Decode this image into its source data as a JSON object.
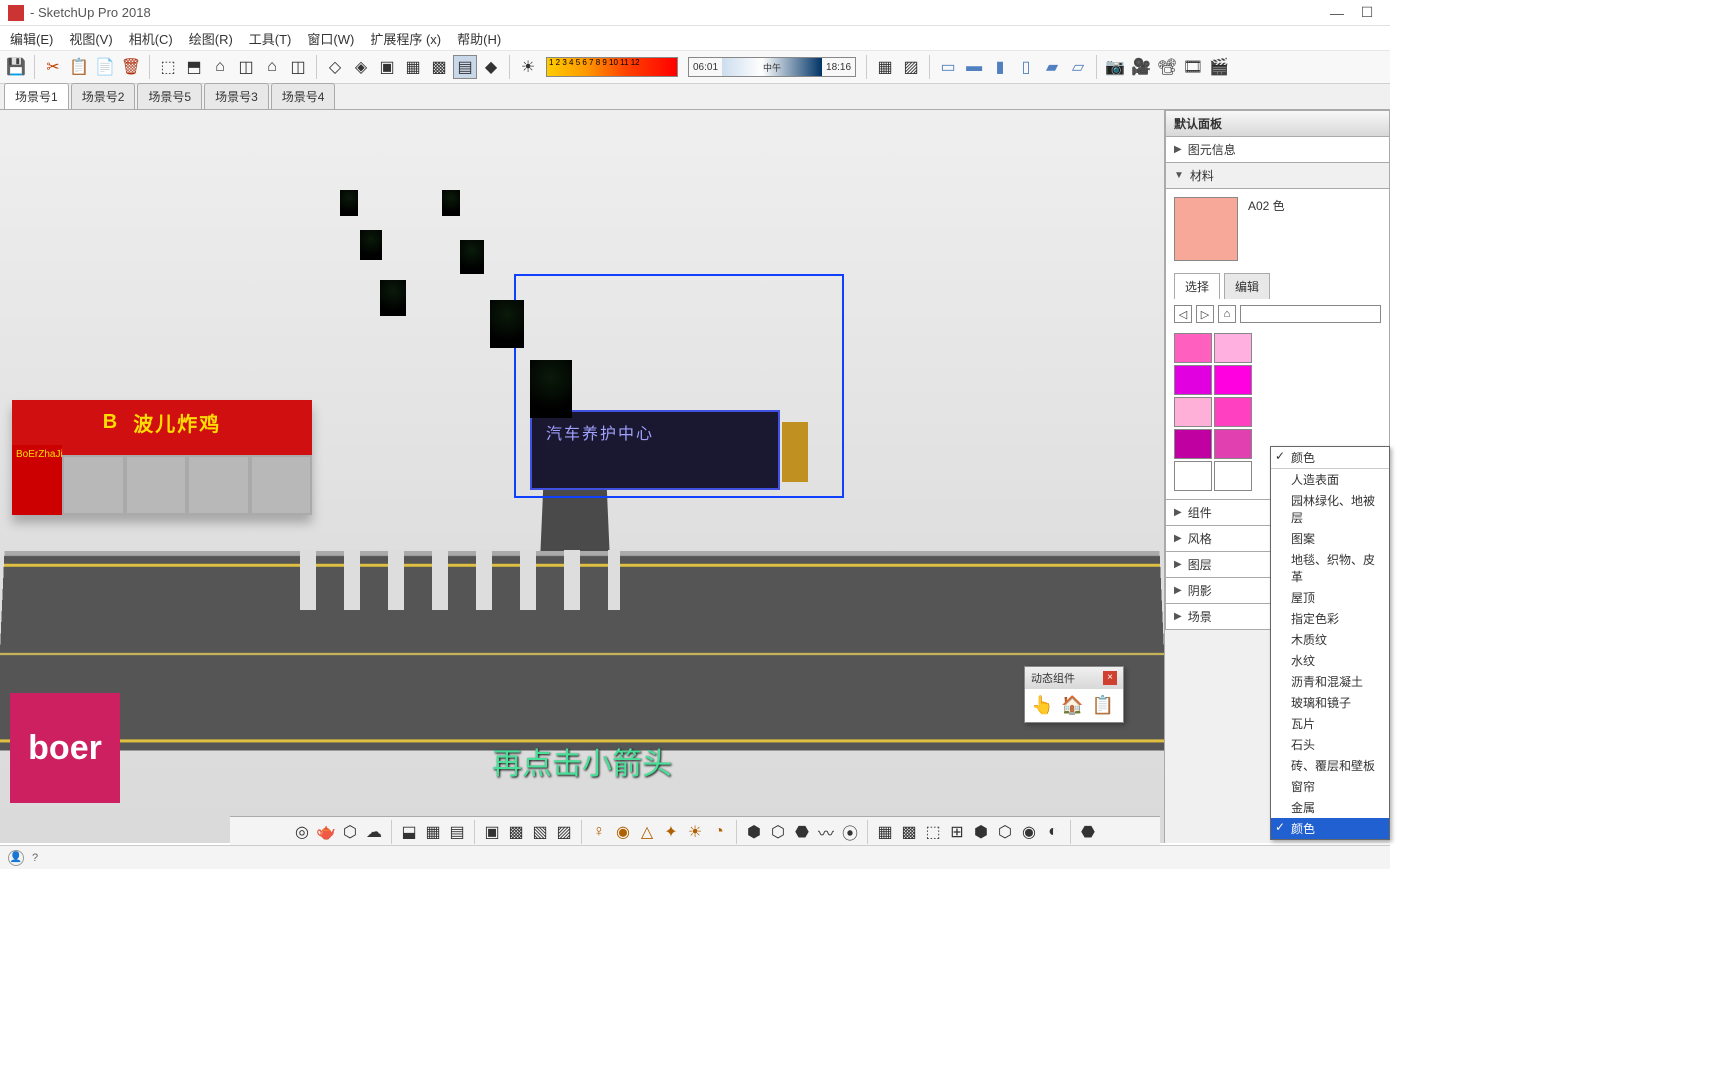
{
  "app": {
    "title": "- SketchUp Pro 2018"
  },
  "menu": {
    "items": [
      "编辑(E)",
      "视图(V)",
      "相机(C)",
      "绘图(R)",
      "工具(T)",
      "窗口(W)",
      "扩展程序 (x)",
      "帮助(H)"
    ]
  },
  "shadowBar": {
    "ticks": "1 2 3 4 5 6 7 8 9 10 11 12",
    "t1": "06:01",
    "mid": "中午",
    "t2": "18:16"
  },
  "scenes": {
    "tabs": [
      "场景号1",
      "场景号2",
      "场景号5",
      "场景号3",
      "场景号4"
    ],
    "active": 0
  },
  "signs": {
    "red_main": "波儿炸鸡",
    "red_sub": "BoErZhaJi",
    "red_logo": "B",
    "dark": "汽车养护中心"
  },
  "caption": "再点击小箭头",
  "panel": {
    "title": "默认面板",
    "sections": [
      "图元信息",
      "材料",
      "组件",
      "风格",
      "图层",
      "阴影",
      "场景"
    ],
    "material": {
      "name": "A02 色",
      "swatch": "#f8a898",
      "tabs": [
        "选择",
        "编辑"
      ],
      "activeTab": 0,
      "colors": [
        "#ff60c0",
        "#ffb0e0",
        "#e000e0",
        "#ff00e0",
        "#ffb0d8",
        "#ff40c0",
        "#c000a0",
        "#e040b0",
        "#ffffff",
        "#ffffff"
      ]
    }
  },
  "dropdown": {
    "header": "颜色",
    "items": [
      "人造表面",
      "园林绿化、地被层",
      "图案",
      "地毯、织物、皮革",
      "屋顶",
      "指定色彩",
      "木质纹",
      "水纹",
      "沥青和混凝土",
      "玻璃和镜子",
      "瓦片",
      "石头",
      "砖、覆层和壁板",
      "窗帘",
      "金属",
      "颜色"
    ],
    "selected": "颜色"
  },
  "dyncomp": {
    "title": "动态组件"
  },
  "watermark": "boer"
}
